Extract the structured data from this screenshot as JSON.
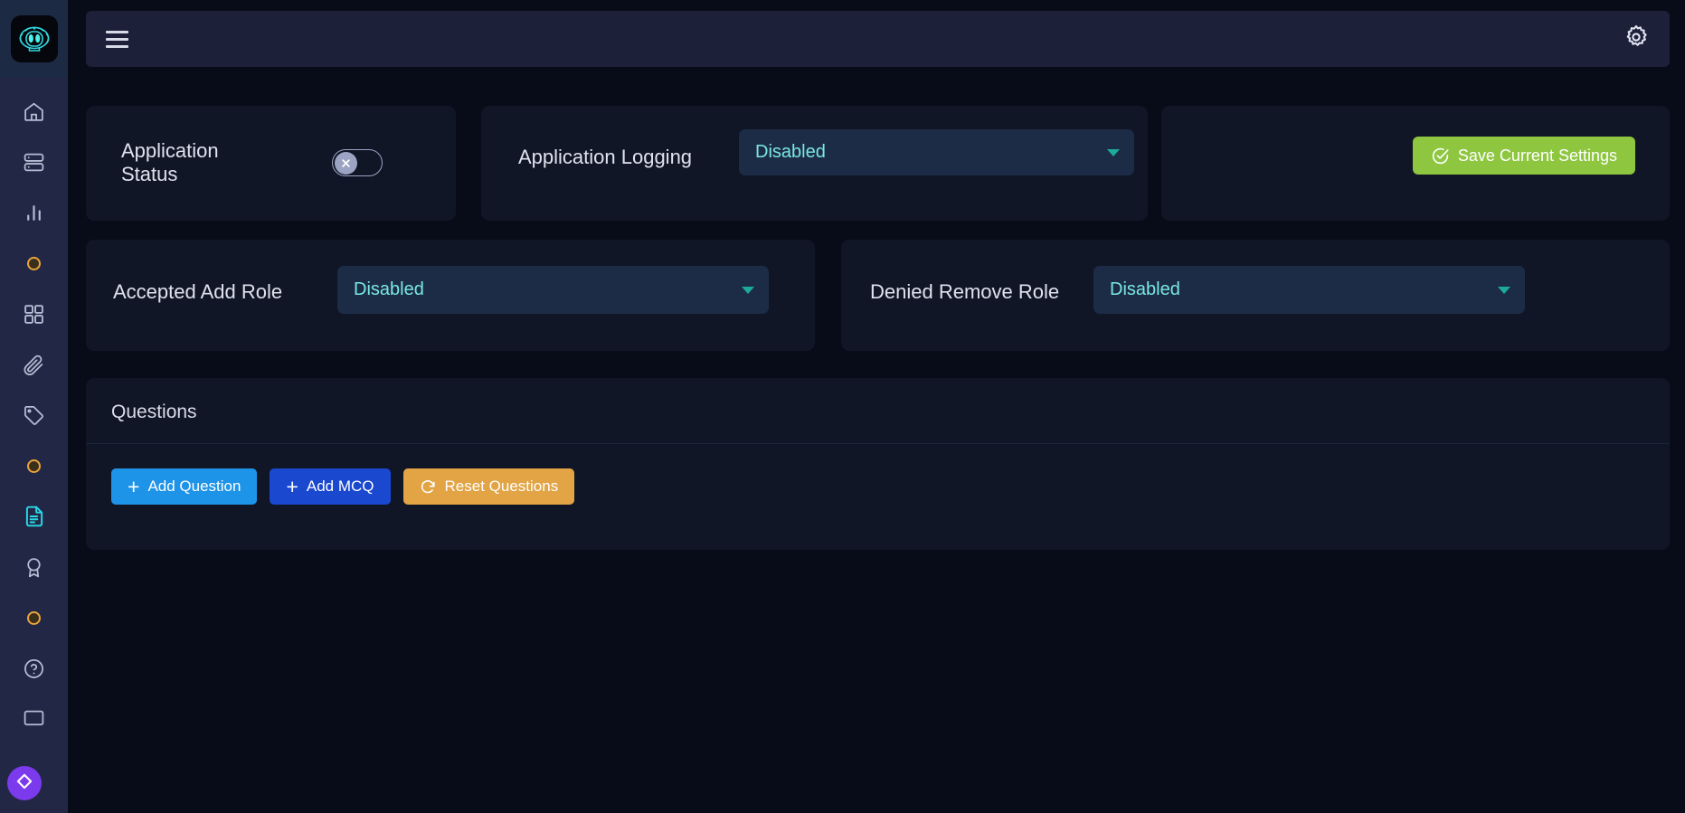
{
  "sidebar": {
    "logo_icon": "robot-head-icon",
    "items": [
      {
        "icon": "home-icon",
        "type": "icon"
      },
      {
        "icon": "server-icon",
        "type": "icon"
      },
      {
        "icon": "bar-chart-icon",
        "type": "icon"
      },
      {
        "icon": "orange-ring-icon",
        "type": "dot"
      },
      {
        "icon": "grid-icon",
        "type": "icon"
      },
      {
        "icon": "paperclip-icon",
        "type": "icon"
      },
      {
        "icon": "tag-icon",
        "type": "icon"
      },
      {
        "icon": "orange-ring-icon",
        "type": "dot"
      },
      {
        "icon": "document-icon",
        "type": "icon",
        "active": true
      },
      {
        "icon": "award-icon",
        "type": "icon"
      },
      {
        "icon": "orange-ring-icon",
        "type": "dot"
      },
      {
        "icon": "help-circle-icon",
        "type": "icon"
      },
      {
        "icon": "monitor-icon",
        "type": "icon"
      }
    ],
    "badge_icon": "diamond-icon"
  },
  "topbar": {
    "menu_icon": "hamburger-menu-icon",
    "settings_icon": "gear-icon"
  },
  "cards": {
    "application_status": {
      "label": "Application Status",
      "toggle_state": "off",
      "toggle_glyph": "×"
    },
    "application_logging": {
      "label": "Application Logging",
      "value": "Disabled"
    },
    "save": {
      "label": "Save Current Settings",
      "icon": "check-circle-icon",
      "color": "#8ec640"
    },
    "accepted_add_role": {
      "label": "Accepted Add Role",
      "value": "Disabled"
    },
    "denied_remove_role": {
      "label": "Denied Remove Role",
      "value": "Disabled"
    }
  },
  "questions": {
    "title": "Questions",
    "buttons": [
      {
        "label": "Add Question",
        "icon": "plus-icon",
        "color": "#1e94e8"
      },
      {
        "label": "Add MCQ",
        "icon": "plus-icon",
        "color": "#1a48cf"
      },
      {
        "label": "Reset Questions",
        "icon": "refresh-icon",
        "color": "#e2a444"
      }
    ]
  }
}
